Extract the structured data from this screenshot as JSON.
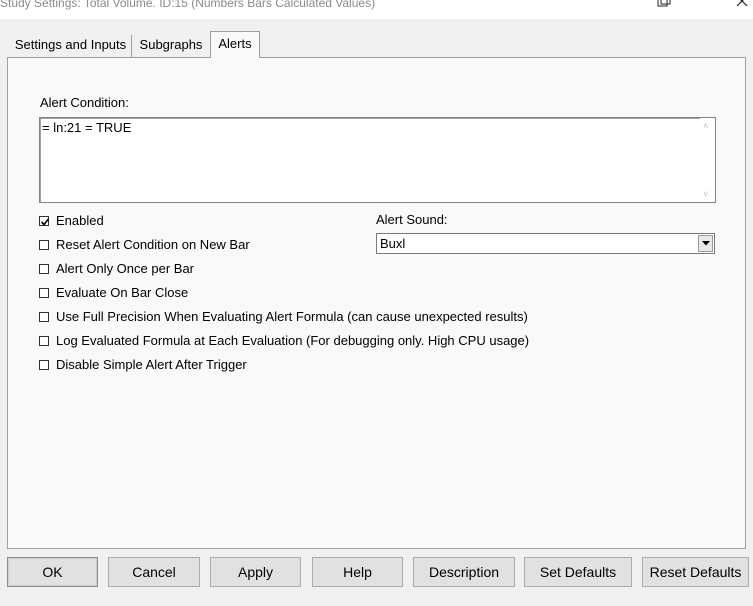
{
  "window": {
    "title": "Study Settings:  Total Volume. ID:15 (Numbers Bars Calculated Values)",
    "restore_icon": "restore-window-icon",
    "close_icon": "close-icon"
  },
  "tabs": [
    {
      "label": "Settings and Inputs",
      "active": false
    },
    {
      "label": "Subgraphs",
      "active": false
    },
    {
      "label": "Alerts",
      "active": true
    }
  ],
  "alert_condition": {
    "label": "Alert Condition:",
    "value": "= ln:21 = TRUE"
  },
  "alert_sound": {
    "label": "Alert Sound:",
    "selected": "Buxl"
  },
  "checkboxes": [
    {
      "label": "Enabled",
      "checked": true
    },
    {
      "label": "Reset Alert Condition on New Bar",
      "checked": false
    },
    {
      "label": "Alert Only Once per Bar",
      "checked": false
    },
    {
      "label": "Evaluate On Bar Close",
      "checked": false
    },
    {
      "label": "Use Full Precision When Evaluating Alert Formula (can cause unexpected results)",
      "checked": false
    },
    {
      "label": "Log Evaluated Formula at Each Evaluation (For debugging only. High CPU usage)",
      "checked": false
    },
    {
      "label": "Disable Simple Alert After Trigger",
      "checked": false
    }
  ],
  "buttons": {
    "ok": "OK",
    "cancel": "Cancel",
    "apply": "Apply",
    "help": "Help",
    "description": "Description",
    "set_defaults": "Set Defaults",
    "reset_defaults": "Reset Defaults"
  },
  "colors": {
    "dialog_bg": "#f0f0f0",
    "panel_bg": "#f9f9f9",
    "title_text": "#8a8a8a"
  }
}
